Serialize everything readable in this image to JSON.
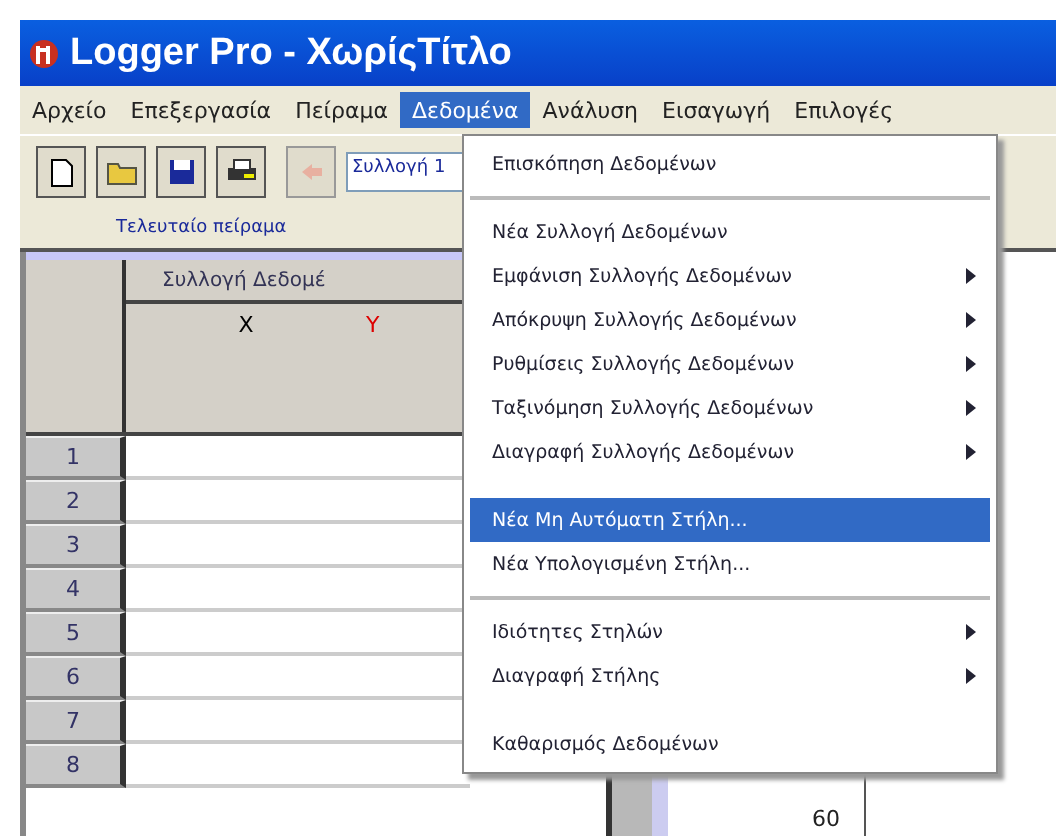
{
  "window": {
    "title": "Logger Pro - ΧωρίςΤίτλο"
  },
  "menu_bar": [
    {
      "label": "Αρχείο",
      "selected": false
    },
    {
      "label": "Επεξεργασία",
      "selected": false
    },
    {
      "label": "Πείραμα",
      "selected": false
    },
    {
      "label": "Δεδομένα",
      "selected": true
    },
    {
      "label": "Ανάλυση",
      "selected": false
    },
    {
      "label": "Εισαγωγή",
      "selected": false
    },
    {
      "label": "Επιλογές",
      "selected": false
    }
  ],
  "toolbar": {
    "data_set_field": "Συλλογή 1",
    "run_label": "Τελευταίο πείραμα"
  },
  "table": {
    "group_header": "Συλλογή Δεδομέ",
    "columns": [
      "X",
      "Y"
    ],
    "row_numbers": [
      "1",
      "2",
      "3",
      "4",
      "5",
      "6",
      "7",
      "8"
    ]
  },
  "graph": {
    "axis_label": "60"
  },
  "dropdown_menu": [
    {
      "kind": "item",
      "label": "Επισκόπηση Δεδομένων",
      "submenu": false,
      "selected": false,
      "disabled": false
    },
    {
      "kind": "separator"
    },
    {
      "kind": "item",
      "label": "Νέα Συλλογή Δεδομένων",
      "submenu": false,
      "selected": false,
      "disabled": false
    },
    {
      "kind": "item",
      "label": "Εμφάνιση Συλλογής Δεδομένων",
      "submenu": true,
      "selected": false,
      "disabled": false
    },
    {
      "kind": "item",
      "label": "Απόκρυψη Συλλογής Δεδομένων",
      "submenu": true,
      "selected": false,
      "disabled": false
    },
    {
      "kind": "item",
      "label": "Ρυθμίσεις Συλλογής Δεδομένων",
      "submenu": true,
      "selected": false,
      "disabled": false
    },
    {
      "kind": "item",
      "label": "Ταξινόμηση Συλλογής Δεδομένων",
      "submenu": true,
      "selected": false,
      "disabled": false
    },
    {
      "kind": "item",
      "label": "Διαγραφή Συλλογής Δεδομένων",
      "submenu": true,
      "selected": false,
      "disabled": false
    },
    {
      "kind": "spacer"
    },
    {
      "kind": "item",
      "label": "Νέα Μη Αυτόματη Στήλη...",
      "submenu": false,
      "selected": true,
      "disabled": false
    },
    {
      "kind": "item",
      "label": "Νέα Υπολογισμένη Στήλη...",
      "submenu": false,
      "selected": false,
      "disabled": false
    },
    {
      "kind": "separator"
    },
    {
      "kind": "item",
      "label": "Ιδιότητες Στηλών",
      "submenu": true,
      "selected": false,
      "disabled": false
    },
    {
      "kind": "item",
      "label": "Διαγραφή Στήλης",
      "submenu": true,
      "selected": false,
      "disabled": false
    },
    {
      "kind": "spacer"
    },
    {
      "kind": "item",
      "label": "Καθαρισμός Δεδομένων",
      "submenu": false,
      "selected": false,
      "disabled": false
    }
  ]
}
